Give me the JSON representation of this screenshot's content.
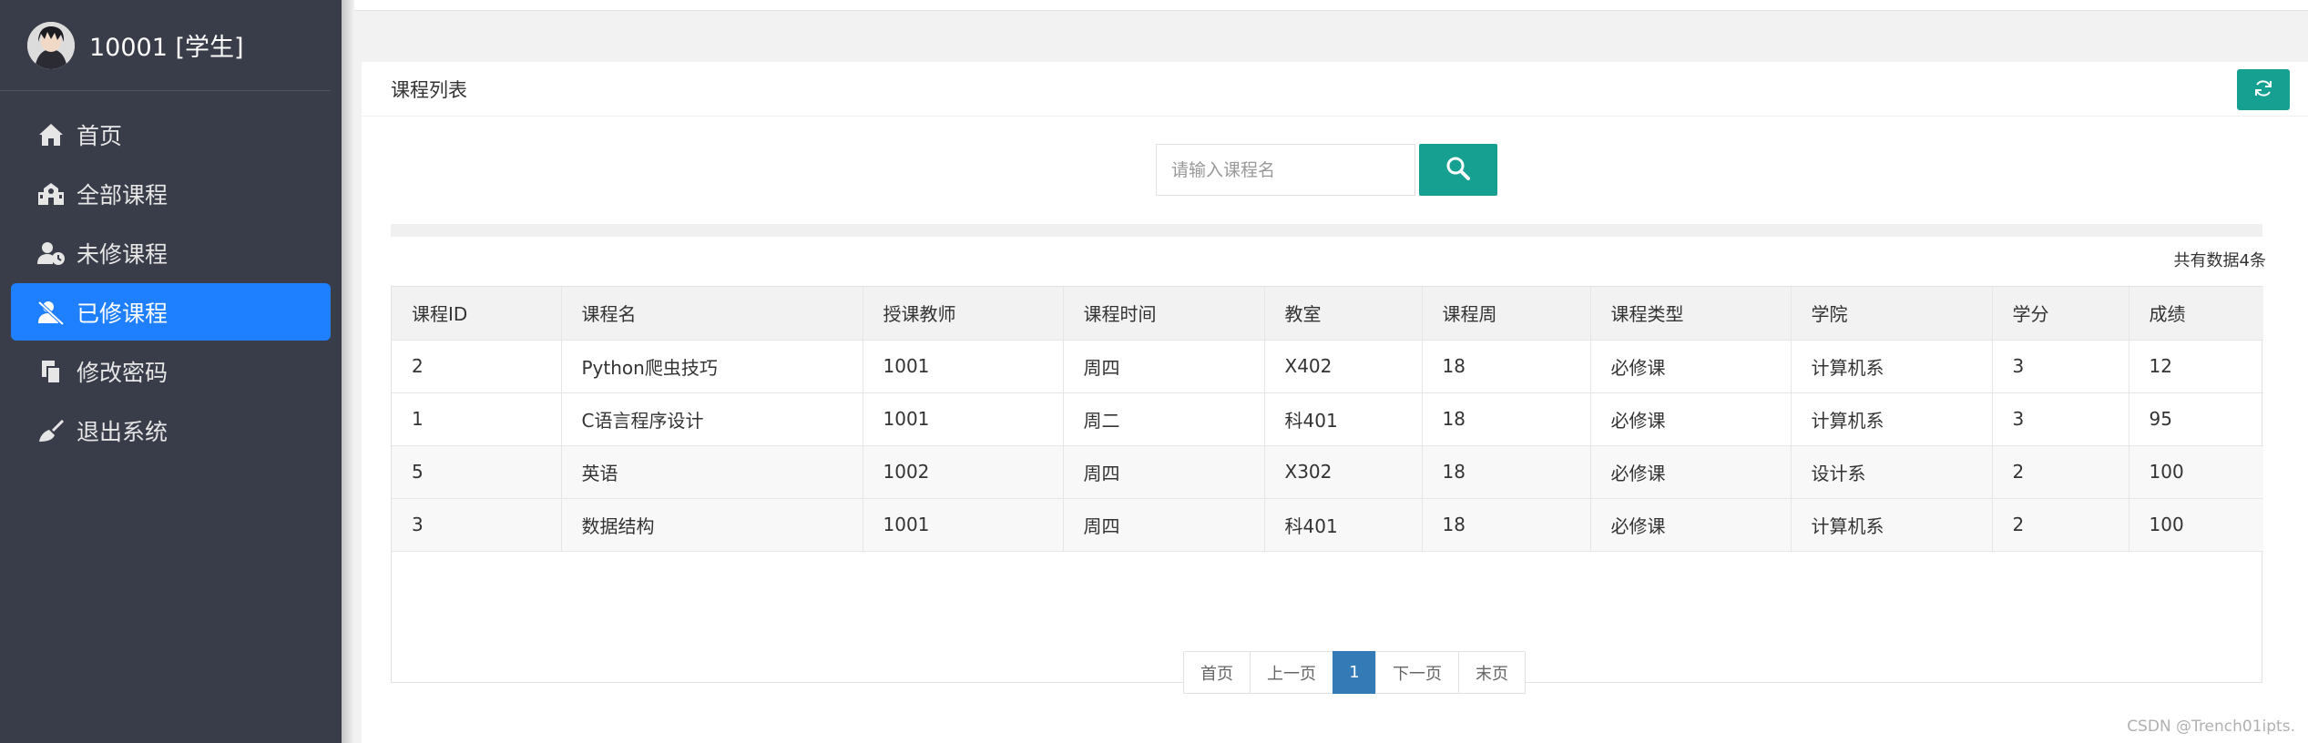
{
  "user": {
    "name": "10001 [学生]"
  },
  "menu": [
    {
      "label": "首页",
      "icon": "home-icon"
    },
    {
      "label": "全部课程",
      "icon": "school-icon"
    },
    {
      "label": "未修课程",
      "icon": "user-clock-icon"
    },
    {
      "label": "已修课程",
      "icon": "user-check-icon",
      "active": true
    },
    {
      "label": "修改密码",
      "icon": "copy-icon"
    },
    {
      "label": "退出系统",
      "icon": "broom-icon"
    }
  ],
  "panel": {
    "title": "课程列表"
  },
  "search": {
    "placeholder": "请输入课程名",
    "value": ""
  },
  "total_text": "共有数据4条",
  "table": {
    "headers": [
      "课程ID",
      "课程名",
      "授课教师",
      "课程时间",
      "教室",
      "课程周",
      "课程类型",
      "学院",
      "学分",
      "成绩"
    ],
    "rows": [
      [
        "2",
        "Python爬虫技巧",
        "1001",
        "周四",
        "X402",
        "18",
        "必修课",
        "计算机系",
        "3",
        "12"
      ],
      [
        "1",
        "C语言程序设计",
        "1001",
        "周二",
        "科401",
        "18",
        "必修课",
        "计算机系",
        "3",
        "95"
      ],
      [
        "5",
        "英语",
        "1002",
        "周四",
        "X302",
        "18",
        "必修课",
        "设计系",
        "2",
        "100"
      ],
      [
        "3",
        "数据结构",
        "1001",
        "周四",
        "科401",
        "18",
        "必修课",
        "计算机系",
        "2",
        "100"
      ]
    ]
  },
  "pagination": {
    "first": "首页",
    "prev": "上一页",
    "current": "1",
    "next": "下一页",
    "last": "末页"
  },
  "watermark": "CSDN @Trench01ipts.",
  "colors": {
    "sidebar_bg": "#393d49",
    "active_item": "#1e7fff",
    "teal_button": "#16a091",
    "page_current": "#337ab7"
  }
}
